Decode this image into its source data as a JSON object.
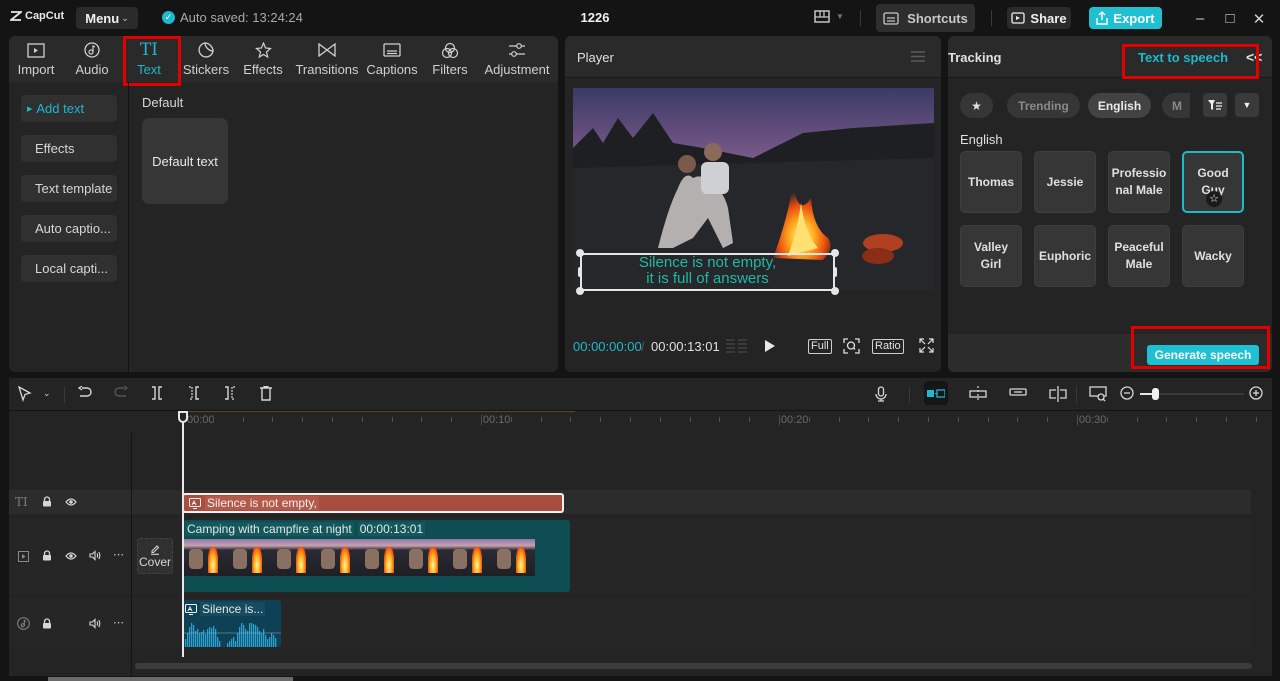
{
  "titlebar": {
    "app_name": "CapCut",
    "menu_label": "Menu",
    "autosave_text": "Auto saved: 13:24:24",
    "project_title": "1226",
    "shortcuts_label": "Shortcuts",
    "share_label": "Share",
    "export_label": "Export",
    "accent_color": "#1ec0d1"
  },
  "toolbar_tabs": [
    {
      "label": "Import",
      "icon": "import-icon"
    },
    {
      "label": "Audio",
      "icon": "audio-icon"
    },
    {
      "label": "Text",
      "icon": "text-icon",
      "active": true
    },
    {
      "label": "Stickers",
      "icon": "stickers-icon"
    },
    {
      "label": "Effects",
      "icon": "effects-icon"
    },
    {
      "label": "Transitions",
      "icon": "transitions-icon"
    },
    {
      "label": "Captions",
      "icon": "captions-icon"
    },
    {
      "label": "Filters",
      "icon": "filters-icon"
    },
    {
      "label": "Adjustment",
      "icon": "adjustment-icon"
    }
  ],
  "text_panel": {
    "subnav": [
      {
        "label": "Add text",
        "active": true
      },
      {
        "label": "Effects"
      },
      {
        "label": "Text template"
      },
      {
        "label": "Auto captio..."
      },
      {
        "label": "Local capti..."
      }
    ],
    "section_label": "Default",
    "default_card_label": "Default text"
  },
  "player": {
    "title": "Player",
    "caption_line1": "Silence is not empty,",
    "caption_line2": "it is full of answers",
    "current_time": "00:00:00:00",
    "time_separator": "/",
    "total_time": "00:00:13:01",
    "full_label": "Full",
    "ratio_label": "Ratio"
  },
  "right_panel": {
    "tracking_label": "Tracking",
    "tts_label": "Text to speech",
    "chips": [
      "Trending",
      "English",
      "M"
    ],
    "active_chip": "English",
    "language_label": "English",
    "voices": [
      "Thomas",
      "Jessie",
      "Professio nal Male",
      "Good Guy",
      "Valley Girl",
      "Euphoric",
      "Peaceful Male",
      "Wacky"
    ],
    "selected_voice": "Good Guy",
    "generate_label": "Generate speech"
  },
  "timeline": {
    "ruler_labels": [
      "00:00",
      "00:10",
      "00:20",
      "00:30"
    ],
    "text_clip_label": "Silence is not empty,",
    "video_clip_label": "Camping with campfire at night",
    "video_clip_duration": "00:00:13:01",
    "audio_clip_label": "Silence is...",
    "cover_label": "Cover",
    "text_track_icon": "TI"
  }
}
